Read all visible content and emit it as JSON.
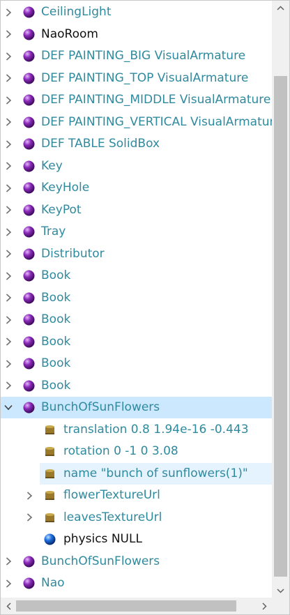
{
  "tree": {
    "rows": [
      {
        "label": "CeilingLight",
        "icon": "node-sphere-purple",
        "chevron": "collapsed"
      },
      {
        "label": "NaoRoom",
        "icon": "node-sphere-purple",
        "chevron": "collapsed"
      },
      {
        "label": "DEF PAINTING_BIG VisualArmature",
        "icon": "node-sphere-purple",
        "chevron": "collapsed"
      },
      {
        "label": "DEF PAINTING_TOP VisualArmature",
        "icon": "node-sphere-purple",
        "chevron": "collapsed"
      },
      {
        "label": "DEF PAINTING_MIDDLE VisualArmature",
        "icon": "node-sphere-purple",
        "chevron": "collapsed"
      },
      {
        "label": "DEF PAINTING_VERTICAL VisualArmature",
        "icon": "node-sphere-purple",
        "chevron": "collapsed"
      },
      {
        "label": "DEF TABLE SolidBox",
        "icon": "node-sphere-purple",
        "chevron": "collapsed"
      },
      {
        "label": "Key",
        "icon": "node-sphere-purple",
        "chevron": "collapsed"
      },
      {
        "label": "KeyHole",
        "icon": "node-sphere-purple",
        "chevron": "collapsed"
      },
      {
        "label": "KeyPot",
        "icon": "node-sphere-purple",
        "chevron": "collapsed"
      },
      {
        "label": "Tray",
        "icon": "node-sphere-purple",
        "chevron": "collapsed"
      },
      {
        "label": "Distributor",
        "icon": "node-sphere-purple",
        "chevron": "collapsed"
      },
      {
        "label": "Book",
        "icon": "node-sphere-purple",
        "chevron": "collapsed"
      },
      {
        "label": "Book",
        "icon": "node-sphere-purple",
        "chevron": "collapsed"
      },
      {
        "label": "Book",
        "icon": "node-sphere-purple",
        "chevron": "collapsed"
      },
      {
        "label": "Book",
        "icon": "node-sphere-purple",
        "chevron": "collapsed"
      },
      {
        "label": "Book",
        "icon": "node-sphere-purple",
        "chevron": "collapsed"
      },
      {
        "label": "Book",
        "icon": "node-sphere-purple",
        "chevron": "collapsed"
      },
      {
        "label": "BunchOfSunFlowers",
        "icon": "node-sphere-purple",
        "chevron": "expanded"
      },
      {
        "label": "translation 0.8 1.94e-16 -0.443",
        "icon": "field-cylinder",
        "chevron": "none"
      },
      {
        "label": "rotation 0 -1 0 3.08",
        "icon": "field-cylinder",
        "chevron": "none"
      },
      {
        "label": "name \"bunch of sunflowers(1)\"",
        "icon": "field-cylinder",
        "chevron": "none"
      },
      {
        "label": "flowerTextureUrl",
        "icon": "field-cylinder",
        "chevron": "collapsed"
      },
      {
        "label": "leavesTextureUrl",
        "icon": "field-cylinder",
        "chevron": "collapsed"
      },
      {
        "label": "physics NULL",
        "icon": "node-sphere-blue",
        "chevron": "none"
      },
      {
        "label": "BunchOfSunFlowers",
        "icon": "node-sphere-purple",
        "chevron": "collapsed"
      },
      {
        "label": "Nao",
        "icon": "node-sphere-purple",
        "chevron": "collapsed"
      }
    ],
    "selected_label": "BunchOfSunFlowers",
    "highlighted_label": "name \"bunch of sunflowers(1)\""
  },
  "colors": {
    "node_text": "#2f8a9e",
    "plain_text": "#111111",
    "selection": "#cce8ff",
    "hover": "#e5f3ff",
    "purple_node": "#8a2bb8",
    "blue_node": "#1e6fe0",
    "field_icon": "#9a7a2a"
  }
}
